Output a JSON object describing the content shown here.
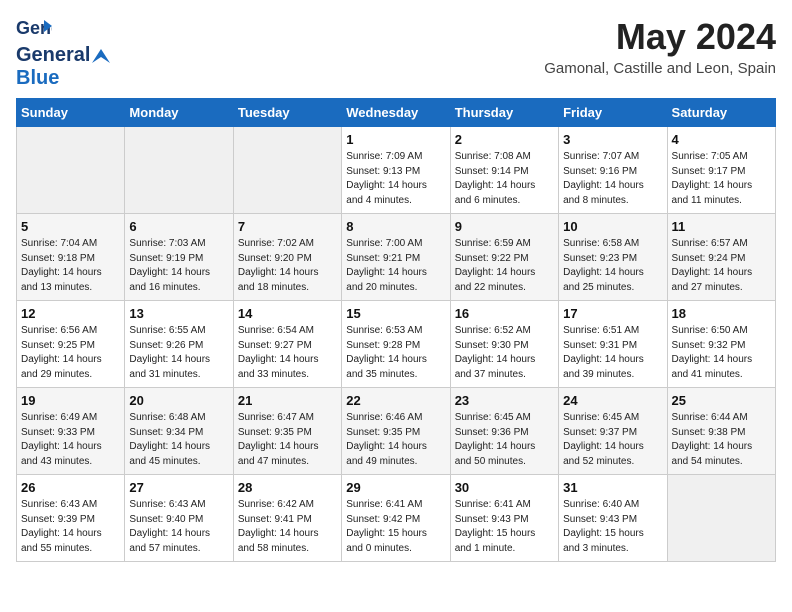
{
  "header": {
    "logo_line1": "General",
    "logo_line2": "Blue",
    "main_title": "May 2024",
    "subtitle": "Gamonal, Castille and Leon, Spain"
  },
  "calendar": {
    "weekdays": [
      "Sunday",
      "Monday",
      "Tuesday",
      "Wednesday",
      "Thursday",
      "Friday",
      "Saturday"
    ],
    "weeks": [
      [
        {
          "day": "",
          "info": ""
        },
        {
          "day": "",
          "info": ""
        },
        {
          "day": "",
          "info": ""
        },
        {
          "day": "1",
          "info": "Sunrise: 7:09 AM\nSunset: 9:13 PM\nDaylight: 14 hours\nand 4 minutes."
        },
        {
          "day": "2",
          "info": "Sunrise: 7:08 AM\nSunset: 9:14 PM\nDaylight: 14 hours\nand 6 minutes."
        },
        {
          "day": "3",
          "info": "Sunrise: 7:07 AM\nSunset: 9:16 PM\nDaylight: 14 hours\nand 8 minutes."
        },
        {
          "day": "4",
          "info": "Sunrise: 7:05 AM\nSunset: 9:17 PM\nDaylight: 14 hours\nand 11 minutes."
        }
      ],
      [
        {
          "day": "5",
          "info": "Sunrise: 7:04 AM\nSunset: 9:18 PM\nDaylight: 14 hours\nand 13 minutes."
        },
        {
          "day": "6",
          "info": "Sunrise: 7:03 AM\nSunset: 9:19 PM\nDaylight: 14 hours\nand 16 minutes."
        },
        {
          "day": "7",
          "info": "Sunrise: 7:02 AM\nSunset: 9:20 PM\nDaylight: 14 hours\nand 18 minutes."
        },
        {
          "day": "8",
          "info": "Sunrise: 7:00 AM\nSunset: 9:21 PM\nDaylight: 14 hours\nand 20 minutes."
        },
        {
          "day": "9",
          "info": "Sunrise: 6:59 AM\nSunset: 9:22 PM\nDaylight: 14 hours\nand 22 minutes."
        },
        {
          "day": "10",
          "info": "Sunrise: 6:58 AM\nSunset: 9:23 PM\nDaylight: 14 hours\nand 25 minutes."
        },
        {
          "day": "11",
          "info": "Sunrise: 6:57 AM\nSunset: 9:24 PM\nDaylight: 14 hours\nand 27 minutes."
        }
      ],
      [
        {
          "day": "12",
          "info": "Sunrise: 6:56 AM\nSunset: 9:25 PM\nDaylight: 14 hours\nand 29 minutes."
        },
        {
          "day": "13",
          "info": "Sunrise: 6:55 AM\nSunset: 9:26 PM\nDaylight: 14 hours\nand 31 minutes."
        },
        {
          "day": "14",
          "info": "Sunrise: 6:54 AM\nSunset: 9:27 PM\nDaylight: 14 hours\nand 33 minutes."
        },
        {
          "day": "15",
          "info": "Sunrise: 6:53 AM\nSunset: 9:28 PM\nDaylight: 14 hours\nand 35 minutes."
        },
        {
          "day": "16",
          "info": "Sunrise: 6:52 AM\nSunset: 9:30 PM\nDaylight: 14 hours\nand 37 minutes."
        },
        {
          "day": "17",
          "info": "Sunrise: 6:51 AM\nSunset: 9:31 PM\nDaylight: 14 hours\nand 39 minutes."
        },
        {
          "day": "18",
          "info": "Sunrise: 6:50 AM\nSunset: 9:32 PM\nDaylight: 14 hours\nand 41 minutes."
        }
      ],
      [
        {
          "day": "19",
          "info": "Sunrise: 6:49 AM\nSunset: 9:33 PM\nDaylight: 14 hours\nand 43 minutes."
        },
        {
          "day": "20",
          "info": "Sunrise: 6:48 AM\nSunset: 9:34 PM\nDaylight: 14 hours\nand 45 minutes."
        },
        {
          "day": "21",
          "info": "Sunrise: 6:47 AM\nSunset: 9:35 PM\nDaylight: 14 hours\nand 47 minutes."
        },
        {
          "day": "22",
          "info": "Sunrise: 6:46 AM\nSunset: 9:35 PM\nDaylight: 14 hours\nand 49 minutes."
        },
        {
          "day": "23",
          "info": "Sunrise: 6:45 AM\nSunset: 9:36 PM\nDaylight: 14 hours\nand 50 minutes."
        },
        {
          "day": "24",
          "info": "Sunrise: 6:45 AM\nSunset: 9:37 PM\nDaylight: 14 hours\nand 52 minutes."
        },
        {
          "day": "25",
          "info": "Sunrise: 6:44 AM\nSunset: 9:38 PM\nDaylight: 14 hours\nand 54 minutes."
        }
      ],
      [
        {
          "day": "26",
          "info": "Sunrise: 6:43 AM\nSunset: 9:39 PM\nDaylight: 14 hours\nand 55 minutes."
        },
        {
          "day": "27",
          "info": "Sunrise: 6:43 AM\nSunset: 9:40 PM\nDaylight: 14 hours\nand 57 minutes."
        },
        {
          "day": "28",
          "info": "Sunrise: 6:42 AM\nSunset: 9:41 PM\nDaylight: 14 hours\nand 58 minutes."
        },
        {
          "day": "29",
          "info": "Sunrise: 6:41 AM\nSunset: 9:42 PM\nDaylight: 15 hours\nand 0 minutes."
        },
        {
          "day": "30",
          "info": "Sunrise: 6:41 AM\nSunset: 9:43 PM\nDaylight: 15 hours\nand 1 minute."
        },
        {
          "day": "31",
          "info": "Sunrise: 6:40 AM\nSunset: 9:43 PM\nDaylight: 15 hours\nand 3 minutes."
        },
        {
          "day": "",
          "info": ""
        }
      ]
    ]
  }
}
